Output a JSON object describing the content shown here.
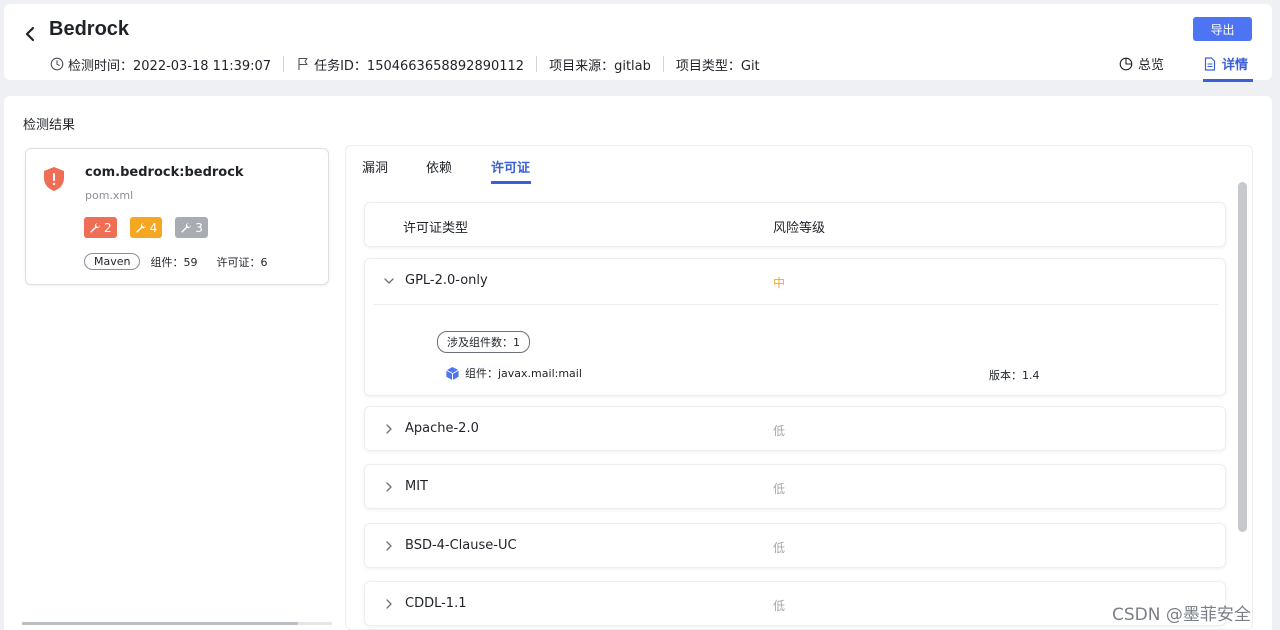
{
  "header": {
    "title": "Bedrock",
    "export_label": "导出",
    "meta": {
      "scan_time": "检测时间：2022-03-18 11:39:07",
      "task_id": "任务ID：1504663658892890112",
      "source": "项目来源：gitlab",
      "project_type": "项目类型：Git"
    },
    "view_tabs": {
      "overview": "总览",
      "detail": "详情"
    }
  },
  "main": {
    "section_title": "检测结果",
    "project": {
      "name": "com.bedrock:bedrock",
      "file": "pom.xml",
      "badges": {
        "high": "2",
        "medium": "4",
        "low": "3"
      },
      "tag": "Maven",
      "components": "组件：59",
      "licenses": "许可证：6"
    },
    "tabs": {
      "vuln": "漏洞",
      "deps": "依赖",
      "license": "许可证"
    },
    "table": {
      "col_type": "许可证类型",
      "col_risk": "风险等级",
      "rows": [
        {
          "name": "GPL-2.0-only",
          "risk": "中"
        },
        {
          "name": "Apache-2.0",
          "risk": "低"
        },
        {
          "name": "MIT",
          "risk": "低"
        },
        {
          "name": "BSD-4-Clause-UC",
          "risk": "低"
        },
        {
          "name": "CDDL-1.1",
          "risk": "低"
        }
      ],
      "expanded": {
        "count_label": "涉及组件数：1",
        "component": "组件：javax.mail:mail",
        "version": "版本：1.4"
      }
    }
  },
  "colors": {
    "primary": "#4d74f2",
    "high": "#ef6e55",
    "medium": "#f5a623",
    "low": "#a9acb2"
  },
  "watermark": "CSDN @墨菲安全"
}
